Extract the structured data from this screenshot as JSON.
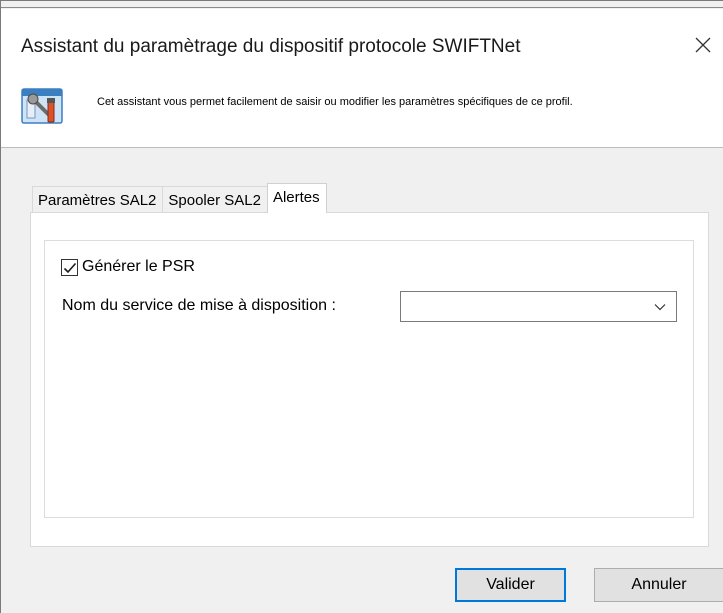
{
  "dialog": {
    "title": "Assistant du paramètrage du dispositif protocole SWIFTNet",
    "description": "Cet assistant vous permet facilement de saisir ou modifier les paramètres spécifiques de ce profil.",
    "close_icon": "close-icon",
    "header_icon": "wizard-tools-icon"
  },
  "tabs": [
    {
      "label": "Paramètres SAL2",
      "active": false
    },
    {
      "label": "Spooler SAL2",
      "active": false
    },
    {
      "label": "Alertes",
      "active": true
    }
  ],
  "alerts": {
    "generate_psr": {
      "label": "Générer le PSR",
      "checked": true
    },
    "service_name": {
      "label": "Nom du service de mise à disposition :",
      "value": ""
    }
  },
  "buttons": {
    "validate": "Valider",
    "cancel": "Annuler"
  },
  "colors": {
    "accent": "#0078d7",
    "window_bg": "#f0f0f0"
  }
}
